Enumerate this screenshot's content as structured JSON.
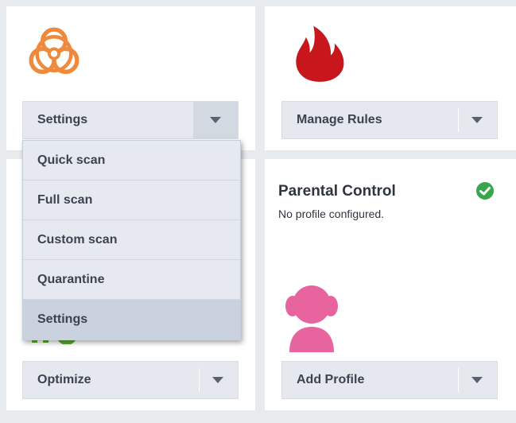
{
  "colors": {
    "background": "#e8ebee",
    "tile": "#ffffff",
    "button": "#e5e9ef",
    "button_text": "#3c4350",
    "biohazard_icon": "#ef8a3c",
    "fire_icon": "#c8161d",
    "parental_icon": "#e8649e",
    "status_ok": "#3aa64c",
    "menu_selected": "#c9d2de"
  },
  "tiles": {
    "antivirus": {
      "icon": "biohazard-icon",
      "button_label": "Settings",
      "menu": {
        "items": [
          {
            "label": "Quick scan"
          },
          {
            "label": "Full scan"
          },
          {
            "label": "Custom scan"
          },
          {
            "label": "Quarantine"
          },
          {
            "label": "Settings",
            "selected": true
          }
        ]
      }
    },
    "firewall": {
      "icon": "fire-icon",
      "button_label": "Manage Rules"
    },
    "optimizer": {
      "button_label": "Optimize"
    },
    "parental": {
      "title": "Parental Control",
      "subtitle": "No profile configured.",
      "status_icon": "check-circle-icon",
      "icon": "child-user-icon",
      "button_label": "Add Profile"
    }
  }
}
